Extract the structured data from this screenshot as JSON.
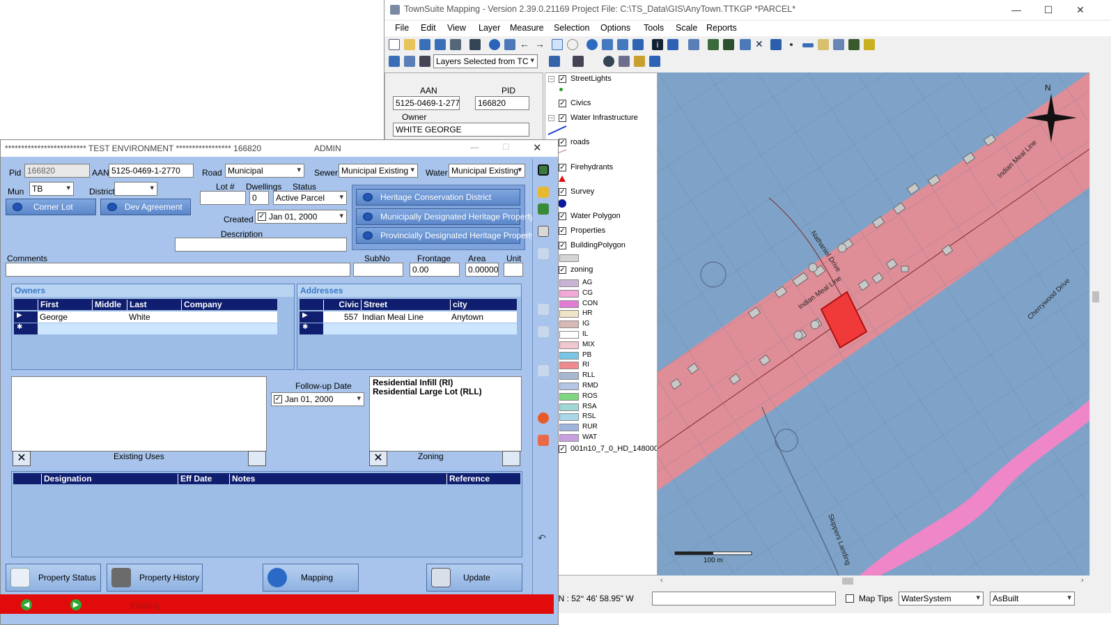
{
  "map_window": {
    "title": "TownSuite Mapping - Version 2.39.0.21169 Project File: C:\\TS_Data\\GIS\\AnyTown.TTKGP *PARCEL*",
    "menu": [
      "File",
      "Edit",
      "View",
      "Layer",
      "Measure",
      "Selection",
      "Options",
      "Tools",
      "Scale",
      "Reports"
    ],
    "layers_dropdown": "Layers Selected from TC",
    "info": {
      "aan_label": "AAN",
      "aan": "5125-0469-1-2770",
      "pid_label": "PID",
      "pid": "166820",
      "owner_label": "Owner",
      "owner": "WHITE GEORGE"
    },
    "layers": [
      {
        "name": "StreetLights",
        "checked": true
      },
      {
        "name": "Civics",
        "checked": true
      },
      {
        "name": "Water Infrastructure",
        "checked": true
      },
      {
        "name": "roads",
        "checked": true
      },
      {
        "name": "Firehydrants",
        "checked": true
      },
      {
        "name": "Survey",
        "checked": true
      },
      {
        "name": "Water Polygon",
        "checked": true
      },
      {
        "name": "Properties",
        "checked": true
      },
      {
        "name": "BuildingPolygon",
        "checked": true
      },
      {
        "name": "zoning",
        "checked": true
      },
      {
        "name": "001n10_7_0_HD_148000",
        "checked": true
      }
    ],
    "zoning_classes": [
      {
        "code": "AG",
        "color": "#c9b4d6"
      },
      {
        "code": "CG",
        "color": "#f2a8d8"
      },
      {
        "code": "CON",
        "color": "#e27bd8"
      },
      {
        "code": "HR",
        "color": "#efe3c8"
      },
      {
        "code": "IG",
        "color": "#d9b8b8"
      },
      {
        "code": "IL",
        "color": "#ffffff"
      },
      {
        "code": "MIX",
        "color": "#f1c8cf"
      },
      {
        "code": "PB",
        "color": "#77c6e8"
      },
      {
        "code": "RI",
        "color": "#f08a8e"
      },
      {
        "code": "RLL",
        "color": "#a8b8d0"
      },
      {
        "code": "RMD",
        "color": "#b4c6e6"
      },
      {
        "code": "ROS",
        "color": "#7ed680"
      },
      {
        "code": "RSA",
        "color": "#9ed7d4"
      },
      {
        "code": "RSL",
        "color": "#a8d8e8"
      },
      {
        "code": "RUR",
        "color": "#a0b4e0"
      },
      {
        "code": "WAT",
        "color": "#c8a0e0"
      }
    ],
    "map_labels": {
      "north": "N",
      "road1": "Indian Meal Line",
      "road2": "Indian Meal Line",
      "road3": "Nathaniel Drive",
      "road4": "Cherrywood Drive",
      "road5": "Skippers Landing",
      "scale": "100 m"
    },
    "status": {
      "coords": "\" N : 52° 46' 58.95\" W",
      "map_tips": "Map Tips",
      "system": "WaterSystem",
      "mode": "AsBuilt"
    }
  },
  "prop_window": {
    "title": "************************* TEST ENVIRONMENT ***************** 166820",
    "user": "ADMIN",
    "pid_label": "Pid",
    "pid": "166820",
    "aan_label": "AAN",
    "aan": "5125-0469-1-2770",
    "road_label": "Road",
    "road": "Municipal",
    "sewer_label": "Sewer",
    "sewer": "Municipal Existing",
    "water_label": "Water",
    "water": "Municipal Existing",
    "mun_label": "Mun",
    "mun": "TB",
    "district_label": "District",
    "district": "",
    "lot_label": "Lot #",
    "lot": "",
    "dwellings_label": "Dwellings",
    "dwellings": "0",
    "status_label": "Status",
    "status": "Active Parcel",
    "corner_lot": "Corner Lot",
    "dev_agreement": "Dev Agreement",
    "created_label": "Created",
    "created": "Jan 01, 2000",
    "description_label": "Description",
    "heritage1": "Heritage Conservation District",
    "heritage2": "Municipally Designated Heritage Property",
    "heritage3": "Provincially Designated Heritage Property",
    "comments_label": "Comments",
    "subno_label": "SubNo",
    "frontage_label": "Frontage",
    "frontage": "0.00",
    "area_label": "Area",
    "area": "0.00000",
    "unit_label": "Unit",
    "owners": {
      "header": "Owners",
      "columns": [
        "First",
        "Middle",
        "Last",
        "Company"
      ],
      "rows": [
        [
          "George",
          "",
          "White",
          ""
        ]
      ]
    },
    "addresses": {
      "header": "Addresses",
      "columns": [
        "Civic",
        "Street",
        "city"
      ],
      "rows": [
        [
          "557",
          "Indian Meal Line",
          "Anytown"
        ]
      ]
    },
    "existing_uses_label": "Existing Uses",
    "followup_label": "Follow-up Date",
    "followup": "Jan 01, 2000",
    "zoning_label": "Zoning",
    "zoning_lines": [
      "Residential Infill (RI)",
      "Residential Large Lot (RLL)"
    ],
    "designation_columns": [
      "Designation",
      "Eff Date",
      "Notes",
      "Reference"
    ],
    "buttons": [
      "Property Status",
      "Property History",
      "Mapping",
      "Update"
    ],
    "bottom_status": "Existing"
  }
}
